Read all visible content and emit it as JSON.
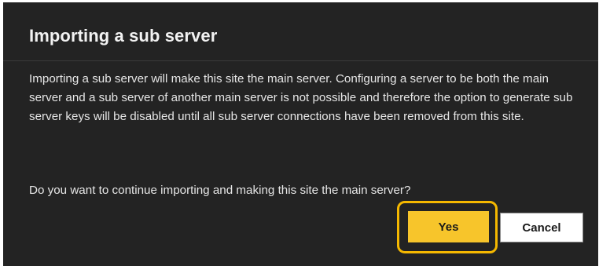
{
  "dialog": {
    "title": "Importing a sub server",
    "message": "Importing a sub server will make this site the main server. Configuring a server to be both the main server and a sub server of another main server is not possible and therefore the option to generate sub server keys will be disabled until all sub server connections have been removed from this site.",
    "question": "Do you want to continue importing and making this site the main server?",
    "buttons": {
      "yes_label": "Yes",
      "cancel_label": "Cancel"
    }
  },
  "colors": {
    "dialog_background": "#232323",
    "primary_button": "#f7c52b",
    "highlight_outline": "#f5b800",
    "text": "#e6e6e6"
  }
}
